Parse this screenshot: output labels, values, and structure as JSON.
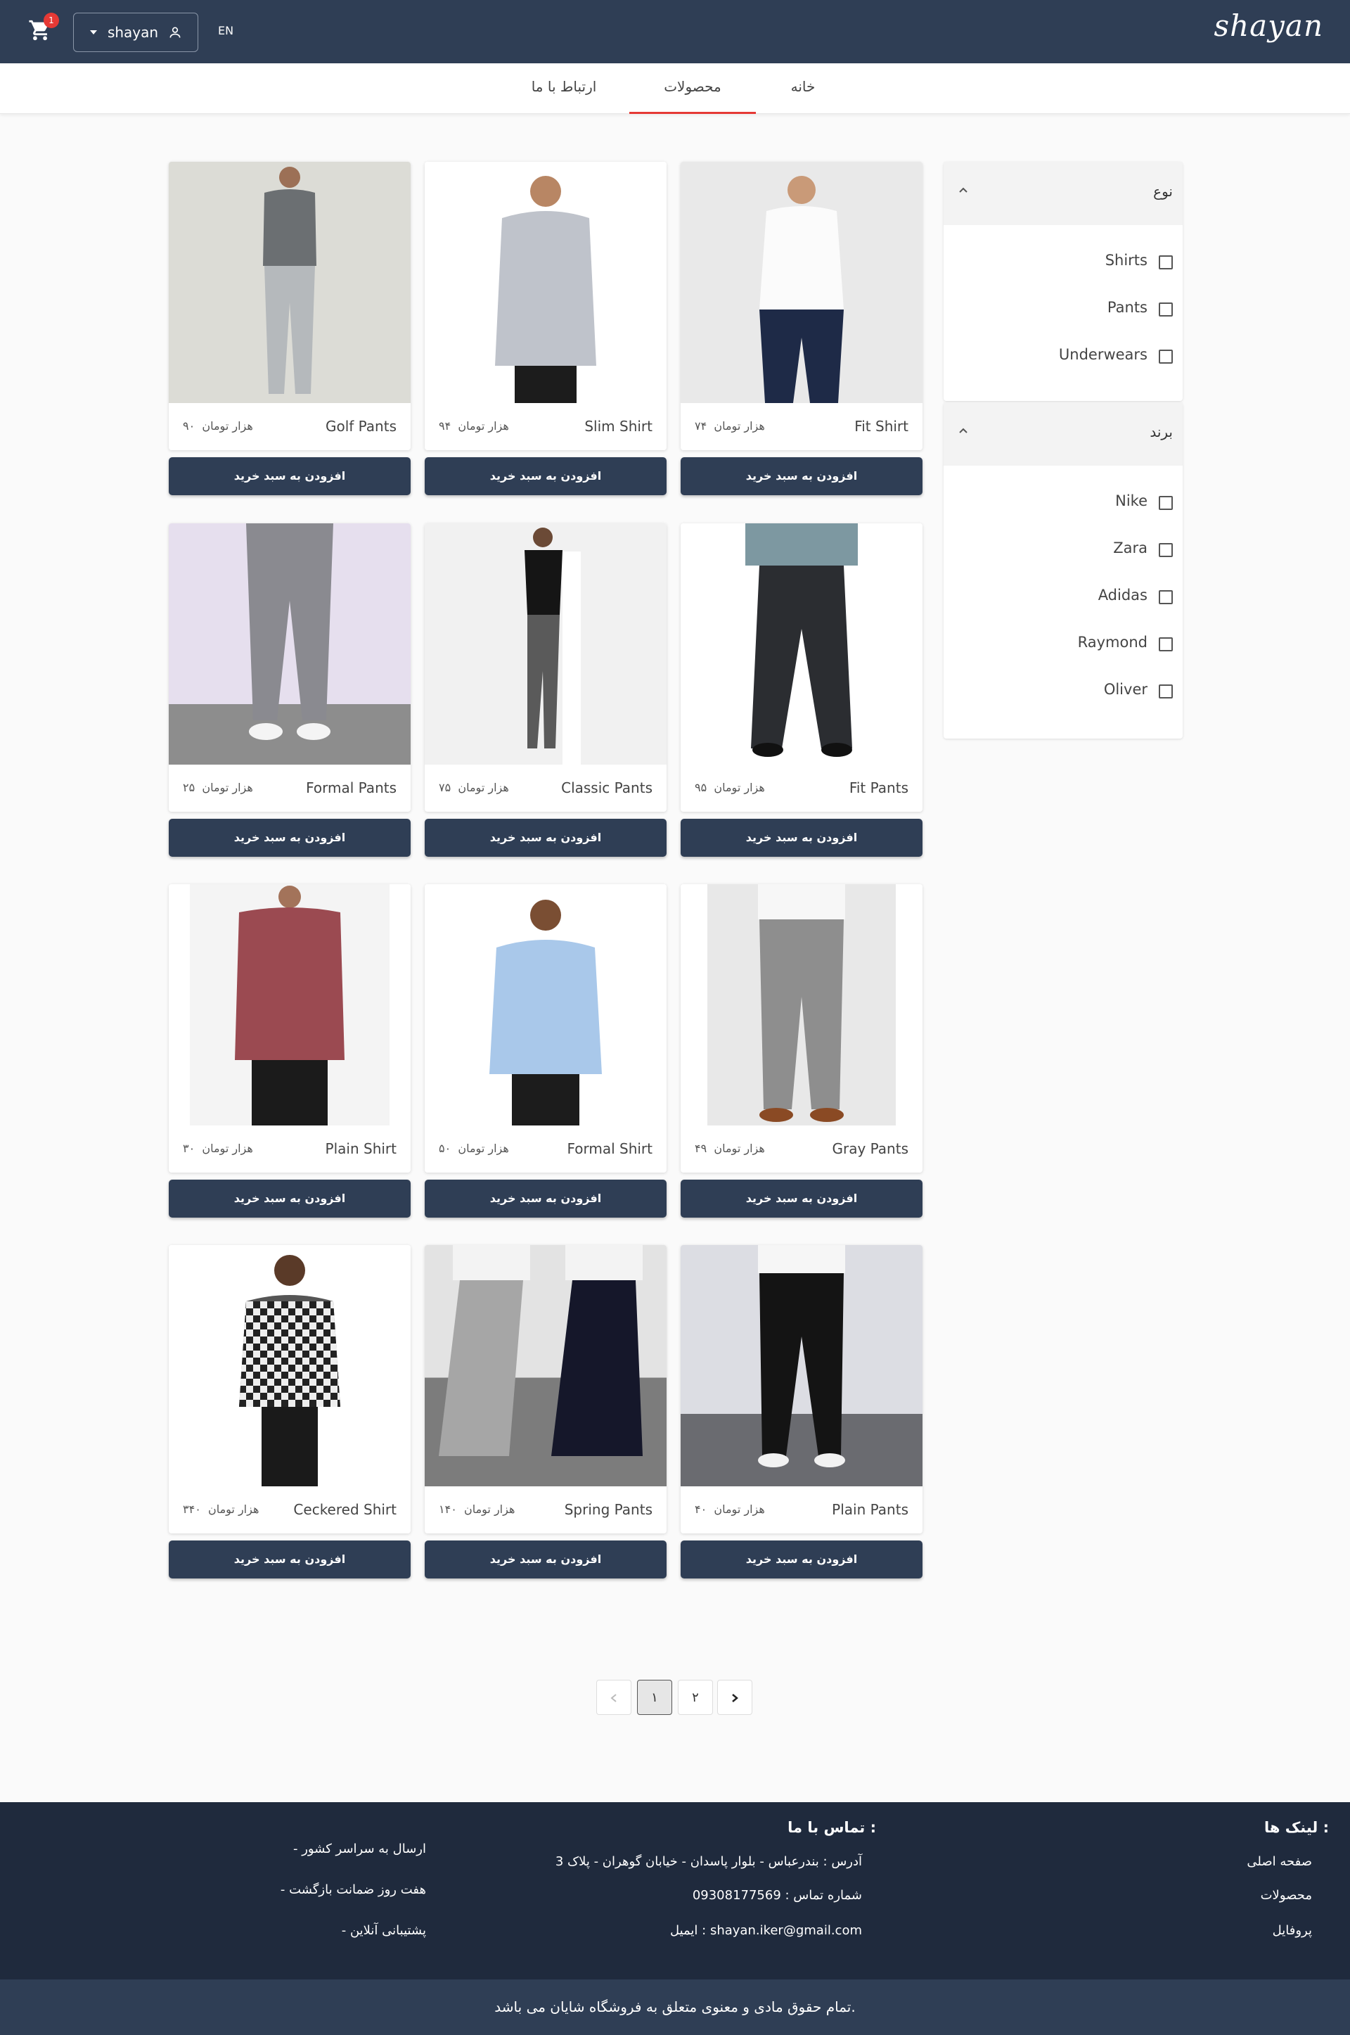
{
  "header": {
    "logo": "shayan",
    "cart_count": "1",
    "user_name": "shayan",
    "lang": "EN"
  },
  "nav": {
    "home": "خانه",
    "products": "محصولات",
    "contact": "ارتباط با ما"
  },
  "filters": {
    "type_title": "نوع",
    "type_options": [
      "Shirts",
      "Pants",
      "Underwears"
    ],
    "brand_title": "برند",
    "brand_options": [
      "Nike",
      "Zara",
      "Adidas",
      "Raymond",
      "Oliver"
    ]
  },
  "price_unit": "هزار تومان",
  "add_to_cart": "افزودن به سبد خرید",
  "products": [
    {
      "name": "Fit Shirt",
      "price": "۷۴"
    },
    {
      "name": "Slim Shirt",
      "price": "۹۴"
    },
    {
      "name": "Golf Pants",
      "price": "۹۰"
    },
    {
      "name": "Fit Pants",
      "price": "۹۵"
    },
    {
      "name": "Classic Pants",
      "price": "۷۵"
    },
    {
      "name": "Formal Pants",
      "price": "۲۵"
    },
    {
      "name": "Gray Pants",
      "price": "۴۹"
    },
    {
      "name": "Formal Shirt",
      "price": "۵۰"
    },
    {
      "name": "Plain Shirt",
      "price": "۳۰"
    },
    {
      "name": "Plain Pants",
      "price": "۴۰"
    },
    {
      "name": "Spring Pants",
      "price": "۱۴۰"
    },
    {
      "name": "Ceckered Shirt",
      "price": "۳۴۰"
    }
  ],
  "pagination": {
    "pages": [
      "۱",
      "۲"
    ]
  },
  "footer": {
    "links_title": "لینک ها :",
    "links": [
      "صفحه اصلی",
      "محصولات",
      "پروفایل"
    ],
    "contact_title": "تماس با ما :",
    "address": "آدرس : بندرعباس - بلوار پاسدان - خیابان گوهران - پلاک 3",
    "phone": "شماره تماس : 09308177569",
    "email": "ایمیل : shayan.iker@gmail.com",
    "features": [
      "- ارسال به سراسر کشور",
      "- هفت روز ضمانت بازگشت",
      "- پشتیبانی آنلاین"
    ],
    "copyright": "تمام حقوق مادی و معنوی متعلق به فروشگاه شایان می باشد."
  },
  "colors": {
    "header_bg": "#2f3e55",
    "footer_bg": "#1f2a3d",
    "accent": "#e53935"
  }
}
